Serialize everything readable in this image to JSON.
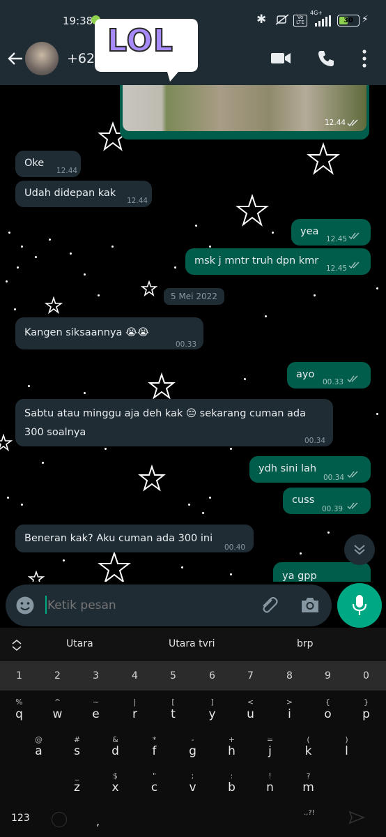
{
  "status_bar": {
    "time": "19:38",
    "battery": "30",
    "network": "4G+"
  },
  "header": {
    "contact_name": "+62 8",
    "sticker_text": "LOL"
  },
  "messages": [
    {
      "text": "Oke",
      "time": "12.44",
      "dir": "in"
    },
    {
      "text": "Udah didepan kak",
      "time": "12.44",
      "dir": "in"
    },
    {
      "text": "yea",
      "time": "12.45",
      "dir": "out"
    },
    {
      "text": "msk j mntr truh dpn kmr",
      "time": "12.45",
      "dir": "out"
    },
    {
      "text": "Kangen siksaannya 😭😭",
      "time": "00.33",
      "dir": "in"
    },
    {
      "text": "ayo",
      "time": "00.33",
      "dir": "out"
    },
    {
      "text": "Sabtu atau minggu aja deh kak 😔 sekarang cuman ada",
      "text2": "300 soalnya",
      "time": "00.34",
      "dir": "in"
    },
    {
      "text": "ydh sini lah",
      "time": "00.34",
      "dir": "out"
    },
    {
      "text": "cuss",
      "time": "00.39",
      "dir": "out"
    },
    {
      "text": "Beneran kak? Aku cuman ada 300 ini",
      "time": "00.40",
      "dir": "in"
    },
    {
      "text": "ya gpp",
      "dir": "out"
    }
  ],
  "image_time": "12.44",
  "date_chip": "5 Mei 2022",
  "input": {
    "placeholder": "Ketik pesan"
  },
  "keyboard": {
    "suggestions": [
      "Utara",
      "Utara tvri",
      "brp"
    ],
    "numbers": [
      "1",
      "2",
      "3",
      "4",
      "5",
      "6",
      "7",
      "8",
      "9",
      "0"
    ],
    "row1": [
      "q",
      "w",
      "e",
      "r",
      "t",
      "y",
      "u",
      "i",
      "o",
      "p"
    ],
    "row1_hints": [
      "%",
      "^",
      "~",
      "|",
      "[",
      "]",
      "<",
      ">",
      "{",
      "}"
    ],
    "row2": [
      "a",
      "s",
      "d",
      "f",
      "g",
      "h",
      "j",
      "k",
      "l"
    ],
    "row2_hints": [
      "@",
      "#",
      "&",
      "*",
      "-",
      "+",
      "=",
      "(",
      ")"
    ],
    "row3": [
      "z",
      "x",
      "c",
      "v",
      "b",
      "n",
      "m"
    ],
    "row3_hints": [
      "_",
      "$",
      "\"",
      ";",
      ":",
      "!",
      "?"
    ],
    "symbols_key": "123",
    "punct_key": ".,?!"
  }
}
